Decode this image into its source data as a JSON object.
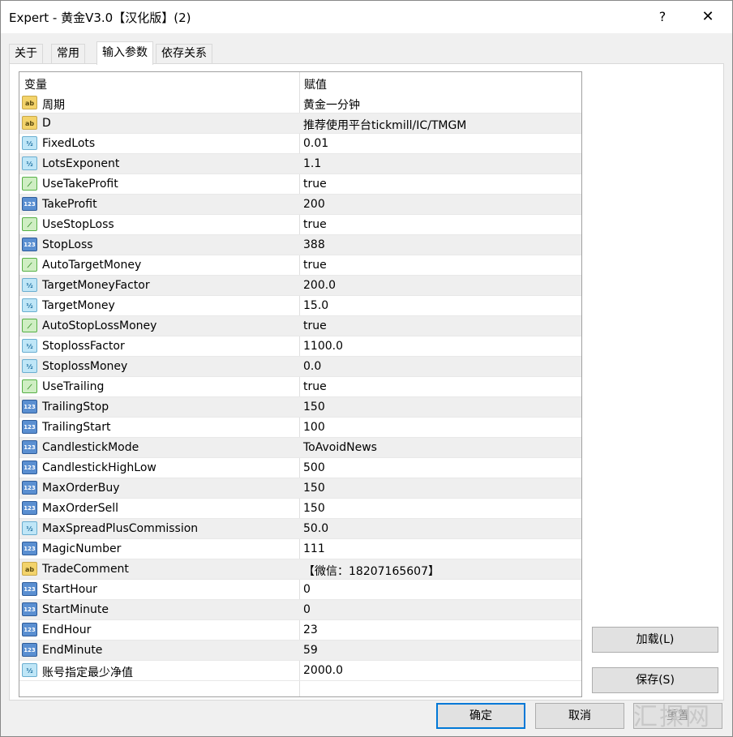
{
  "window": {
    "title": "Expert - 黄金V3.0【汉化版】(2)",
    "help": "?",
    "close": "✕"
  },
  "tabs": [
    {
      "label": "关于"
    },
    {
      "label": "常用"
    },
    {
      "label": "输入参数"
    },
    {
      "label": "依存关系"
    }
  ],
  "grid": {
    "col_variable": "变量",
    "col_value": "赋值",
    "rows": [
      {
        "type": "ab",
        "icon": "ab",
        "name": "周期",
        "value": "黄金一分钟"
      },
      {
        "type": "ab",
        "icon": "ab",
        "name": "D",
        "value": "推荐使用平台tickmill/IC/TMGM"
      },
      {
        "type": "half",
        "icon": "½",
        "name": "FixedLots",
        "value": "0.01"
      },
      {
        "type": "half",
        "icon": "½",
        "name": "LotsExponent",
        "value": "1.1"
      },
      {
        "type": "bool",
        "icon": "⟋",
        "name": "UseTakeProfit",
        "value": "true"
      },
      {
        "type": "n123",
        "icon": "123",
        "name": "TakeProfit",
        "value": "200"
      },
      {
        "type": "bool",
        "icon": "⟋",
        "name": "UseStopLoss",
        "value": "true"
      },
      {
        "type": "n123",
        "icon": "123",
        "name": "StopLoss",
        "value": "388"
      },
      {
        "type": "bool",
        "icon": "⟋",
        "name": "AutoTargetMoney",
        "value": "true"
      },
      {
        "type": "half",
        "icon": "½",
        "name": "TargetMoneyFactor",
        "value": "200.0"
      },
      {
        "type": "half",
        "icon": "½",
        "name": "TargetMoney",
        "value": "15.0"
      },
      {
        "type": "bool",
        "icon": "⟋",
        "name": "AutoStopLossMoney",
        "value": "true"
      },
      {
        "type": "half",
        "icon": "½",
        "name": "StoplossFactor",
        "value": "1100.0"
      },
      {
        "type": "half",
        "icon": "½",
        "name": "StoplossMoney",
        "value": "0.0"
      },
      {
        "type": "bool",
        "icon": "⟋",
        "name": "UseTrailing",
        "value": "true"
      },
      {
        "type": "n123",
        "icon": "123",
        "name": "TrailingStop",
        "value": "150"
      },
      {
        "type": "n123",
        "icon": "123",
        "name": "TrailingStart",
        "value": "100"
      },
      {
        "type": "n123",
        "icon": "123",
        "name": "CandlestickMode",
        "value": "ToAvoidNews"
      },
      {
        "type": "n123",
        "icon": "123",
        "name": "CandlestickHighLow",
        "value": "500"
      },
      {
        "type": "n123",
        "icon": "123",
        "name": "MaxOrderBuy",
        "value": "150"
      },
      {
        "type": "n123",
        "icon": "123",
        "name": "MaxOrderSell",
        "value": "150"
      },
      {
        "type": "half",
        "icon": "½",
        "name": "MaxSpreadPlusCommission",
        "value": "50.0"
      },
      {
        "type": "n123",
        "icon": "123",
        "name": "MagicNumber",
        "value": "111"
      },
      {
        "type": "ab",
        "icon": "ab",
        "name": "TradeComment",
        "value": "【微信：18207165607】"
      },
      {
        "type": "n123",
        "icon": "123",
        "name": "StartHour",
        "value": "0"
      },
      {
        "type": "n123",
        "icon": "123",
        "name": "StartMinute",
        "value": "0"
      },
      {
        "type": "n123",
        "icon": "123",
        "name": "EndHour",
        "value": "23"
      },
      {
        "type": "n123",
        "icon": "123",
        "name": "EndMinute",
        "value": "59"
      },
      {
        "type": "half",
        "icon": "½",
        "name": "账号指定最少净值",
        "value": "2000.0"
      }
    ]
  },
  "buttons": {
    "load": "加载(L)",
    "save": "保存(S)",
    "ok": "确定",
    "cancel": "取消",
    "reset": "重置"
  },
  "watermark": "汇探网"
}
